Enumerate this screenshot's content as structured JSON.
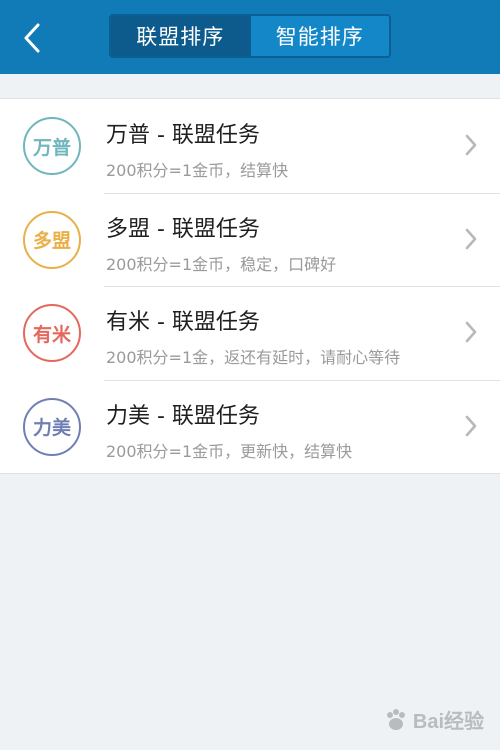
{
  "header": {
    "back_icon": "chevron-left-icon",
    "tabs": [
      {
        "label": "联盟排序",
        "active": true
      },
      {
        "label": "智能排序",
        "active": false
      }
    ],
    "bg_color": "#117bb8",
    "active_tab_color": "#0c5b8c"
  },
  "list": {
    "items": [
      {
        "badge": "万普",
        "badge_color": "#6fb6bd",
        "title": "万普 - 联盟任务",
        "subtitle": "200积分=1金币，结算快"
      },
      {
        "badge": "多盟",
        "badge_color": "#e9b04a",
        "title": "多盟 - 联盟任务",
        "subtitle": "200积分=1金币，稳定，口碑好"
      },
      {
        "badge": "有米",
        "badge_color": "#e4685c",
        "title": "有米 - 联盟任务",
        "subtitle": "200积分=1金，返还有延时，请耐心等待"
      },
      {
        "badge": "力美",
        "badge_color": "#6f7fb3",
        "title": "力美 - 联盟任务",
        "subtitle": "200积分=1金币，更新快，结算快"
      }
    ]
  },
  "watermark": {
    "text": "Bai经验"
  }
}
